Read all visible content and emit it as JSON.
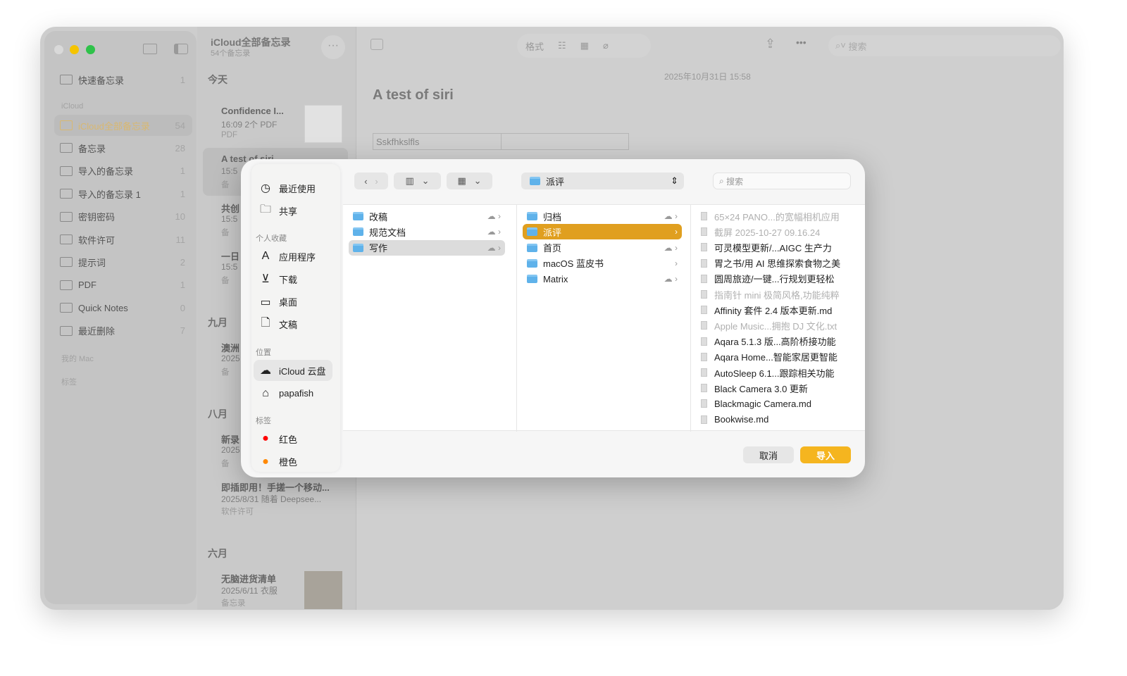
{
  "window": {
    "colors": {
      "accent": "#E0A020",
      "red": "#FF0000",
      "orange": "#FF8800"
    }
  },
  "sidebar": {
    "quick": {
      "label": "快速备忘录",
      "count": "1"
    },
    "section_icloud": "iCloud",
    "folders": [
      {
        "label": "iCloud全部备忘录",
        "count": "54",
        "selected": true
      },
      {
        "label": "备忘录",
        "count": "28"
      },
      {
        "label": "导入的备忘录",
        "count": "1"
      },
      {
        "label": "导入的备忘录 1",
        "count": "1"
      },
      {
        "label": "密钥密码",
        "count": "10"
      },
      {
        "label": "软件许可",
        "count": "11"
      },
      {
        "label": "提示词",
        "count": "2"
      },
      {
        "label": "PDF",
        "count": "1"
      },
      {
        "label": "Quick Notes",
        "count": "0"
      },
      {
        "label": "最近删除",
        "count": "7",
        "icon": "trash-icon"
      }
    ],
    "section_mac": "我的 Mac",
    "section_tags": "标签"
  },
  "notes": {
    "title": "iCloud全部备忘录",
    "subtitle": "54个备忘录",
    "today": "今天",
    "sep": "九月",
    "aug": "八月",
    "jun": "六月",
    "items": [
      {
        "title": "Confidence I...",
        "meta": "16:09  2个 PDF",
        "folder": "PDF"
      },
      {
        "title": "A test of siri",
        "meta": "15:5",
        "folder": "备"
      },
      {
        "title": "共创",
        "meta": "15:5",
        "folder": "备"
      },
      {
        "title": "一日",
        "meta": "15:5",
        "folder": "备"
      },
      {
        "title": "澳洲",
        "meta": "2025",
        "folder": "备"
      },
      {
        "title": "新录",
        "meta": "2025",
        "folder": "备"
      },
      {
        "title": "即插即用！手搓一个移动...",
        "meta": "2025/8/31  随着 Deepsee...",
        "folder": "软件许可"
      },
      {
        "title": "无脑进货清单",
        "meta": "2025/6/11  衣服",
        "folder": "备忘录"
      }
    ]
  },
  "editor": {
    "toolbar": {
      "format": "格式",
      "search": "搜索"
    },
    "date": "2025年10月31日 15:58",
    "title": "A test of siri",
    "cell": "Sskfhkslfls"
  },
  "dialog": {
    "sidebar": {
      "top": [
        {
          "label": "最近使用",
          "icon": "clock-icon",
          "glyph": "◷"
        },
        {
          "label": "共享",
          "icon": "shared-folder-icon",
          "glyph": "🗀"
        }
      ],
      "fav_head": "个人收藏",
      "favs": [
        {
          "label": "应用程序",
          "icon": "apps-icon",
          "glyph": "A"
        },
        {
          "label": "下载",
          "icon": "download-icon",
          "glyph": "⊻"
        },
        {
          "label": "桌面",
          "icon": "desktop-icon",
          "glyph": "▭"
        },
        {
          "label": "文稿",
          "icon": "document-icon",
          "glyph": "🗋"
        }
      ],
      "loc_head": "位置",
      "locs": [
        {
          "label": "iCloud 云盘",
          "icon": "cloud-icon",
          "glyph": "☁"
        },
        {
          "label": "papafish",
          "icon": "home-icon",
          "glyph": "⌂"
        }
      ],
      "tag_head": "标签",
      "tags": [
        {
          "label": "红色",
          "color": "#FF0000"
        },
        {
          "label": "橙色",
          "color": "#FF8800"
        }
      ]
    },
    "path": "派评",
    "search_placeholder": "搜索",
    "col1": [
      {
        "label": "改稿",
        "cloud": true
      },
      {
        "label": "规范文档",
        "cloud": true
      },
      {
        "label": "写作",
        "cloud": true,
        "selected": true
      }
    ],
    "col2": [
      {
        "label": "归档",
        "cloud": true
      },
      {
        "label": "派评",
        "selected": true
      },
      {
        "label": "首页",
        "cloud": true
      },
      {
        "label": "macOS 蓝皮书"
      },
      {
        "label": "Matrix",
        "cloud": true
      }
    ],
    "col3": [
      {
        "label": "65×24 PANO...的宽幅相机应用",
        "dim": true
      },
      {
        "label": "截屏 2025-10-27 09.16.24",
        "dim": true
      },
      {
        "label": "可灵模型更新/...AIGC 生产力"
      },
      {
        "label": "胃之书/用 AI 思维探索食物之美"
      },
      {
        "label": "圆周旅迹/一键...行规划更轻松"
      },
      {
        "label": "指南针 mini 极简风格,功能纯粹",
        "dim": true
      },
      {
        "label": "Affinity 套件 2.4 版本更新.md"
      },
      {
        "label": "Apple Music...拥抱 DJ 文化.txt",
        "dim": true
      },
      {
        "label": "Aqara 5.1.3 版...高阶桥接功能"
      },
      {
        "label": "Aqara Home...智能家居更智能"
      },
      {
        "label": "AutoSleep 6.1...跟踪相关功能"
      },
      {
        "label": "Black Camera 3.0 更新"
      },
      {
        "label": "Blackmagic Camera.md"
      },
      {
        "label": "Bookwise.md"
      }
    ],
    "cancel": "取消",
    "import": "导入"
  }
}
